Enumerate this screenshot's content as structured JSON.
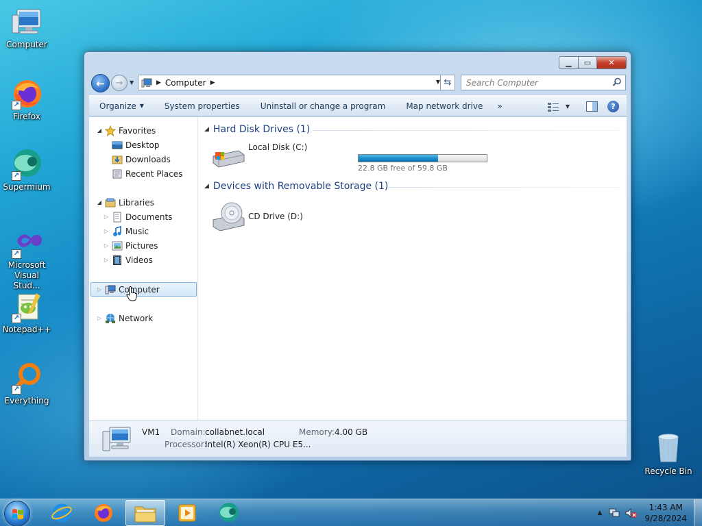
{
  "desktop": {
    "icons": [
      {
        "label": "Computer",
        "icon": "computer-icon"
      },
      {
        "label": "Firefox",
        "icon": "firefox-icon"
      },
      {
        "label": "Supermium",
        "icon": "supermium-icon"
      },
      {
        "label": "Microsoft Visual Stud...",
        "icon": "visual-studio-icon"
      },
      {
        "label": "Notepad++",
        "icon": "notepadpp-icon"
      },
      {
        "label": "Everything",
        "icon": "everything-icon"
      }
    ],
    "recycle_bin": "Recycle Bin"
  },
  "window": {
    "address": {
      "crumb": "Computer"
    },
    "search": {
      "placeholder": "Search Computer"
    },
    "toolbar": {
      "organize": "Organize",
      "system_properties": "System properties",
      "uninstall": "Uninstall or change a program",
      "map_drive": "Map network drive",
      "more": "»"
    },
    "nav": {
      "favorites": "Favorites",
      "desktop": "Desktop",
      "downloads": "Downloads",
      "recent_places": "Recent Places",
      "libraries": "Libraries",
      "documents": "Documents",
      "music": "Music",
      "pictures": "Pictures",
      "videos": "Videos",
      "computer": "Computer",
      "network": "Network"
    },
    "groups": {
      "hdd": "Hard Disk Drives (1)",
      "removable": "Devices with Removable Storage (1)"
    },
    "drives": {
      "c": {
        "name": "Local Disk (C:)",
        "free_text": "22.8 GB free of 59.8 GB",
        "used_fraction": 0.62
      },
      "d": {
        "name": "CD Drive (D:)"
      }
    },
    "details": {
      "name": "VM1",
      "domain_label": "Domain:",
      "domain": "collabnet.local",
      "memory_label": "Memory:",
      "memory": "4.00 GB",
      "processor_label": "Processor:",
      "processor": "Intel(R) Xeon(R) CPU E5..."
    }
  },
  "taskbar": {
    "time": "1:43 AM",
    "date": "9/28/2024"
  },
  "colors": {
    "accent": "#1e3f82",
    "selection": "#d3e7f9",
    "close_button": "#c7402b"
  }
}
